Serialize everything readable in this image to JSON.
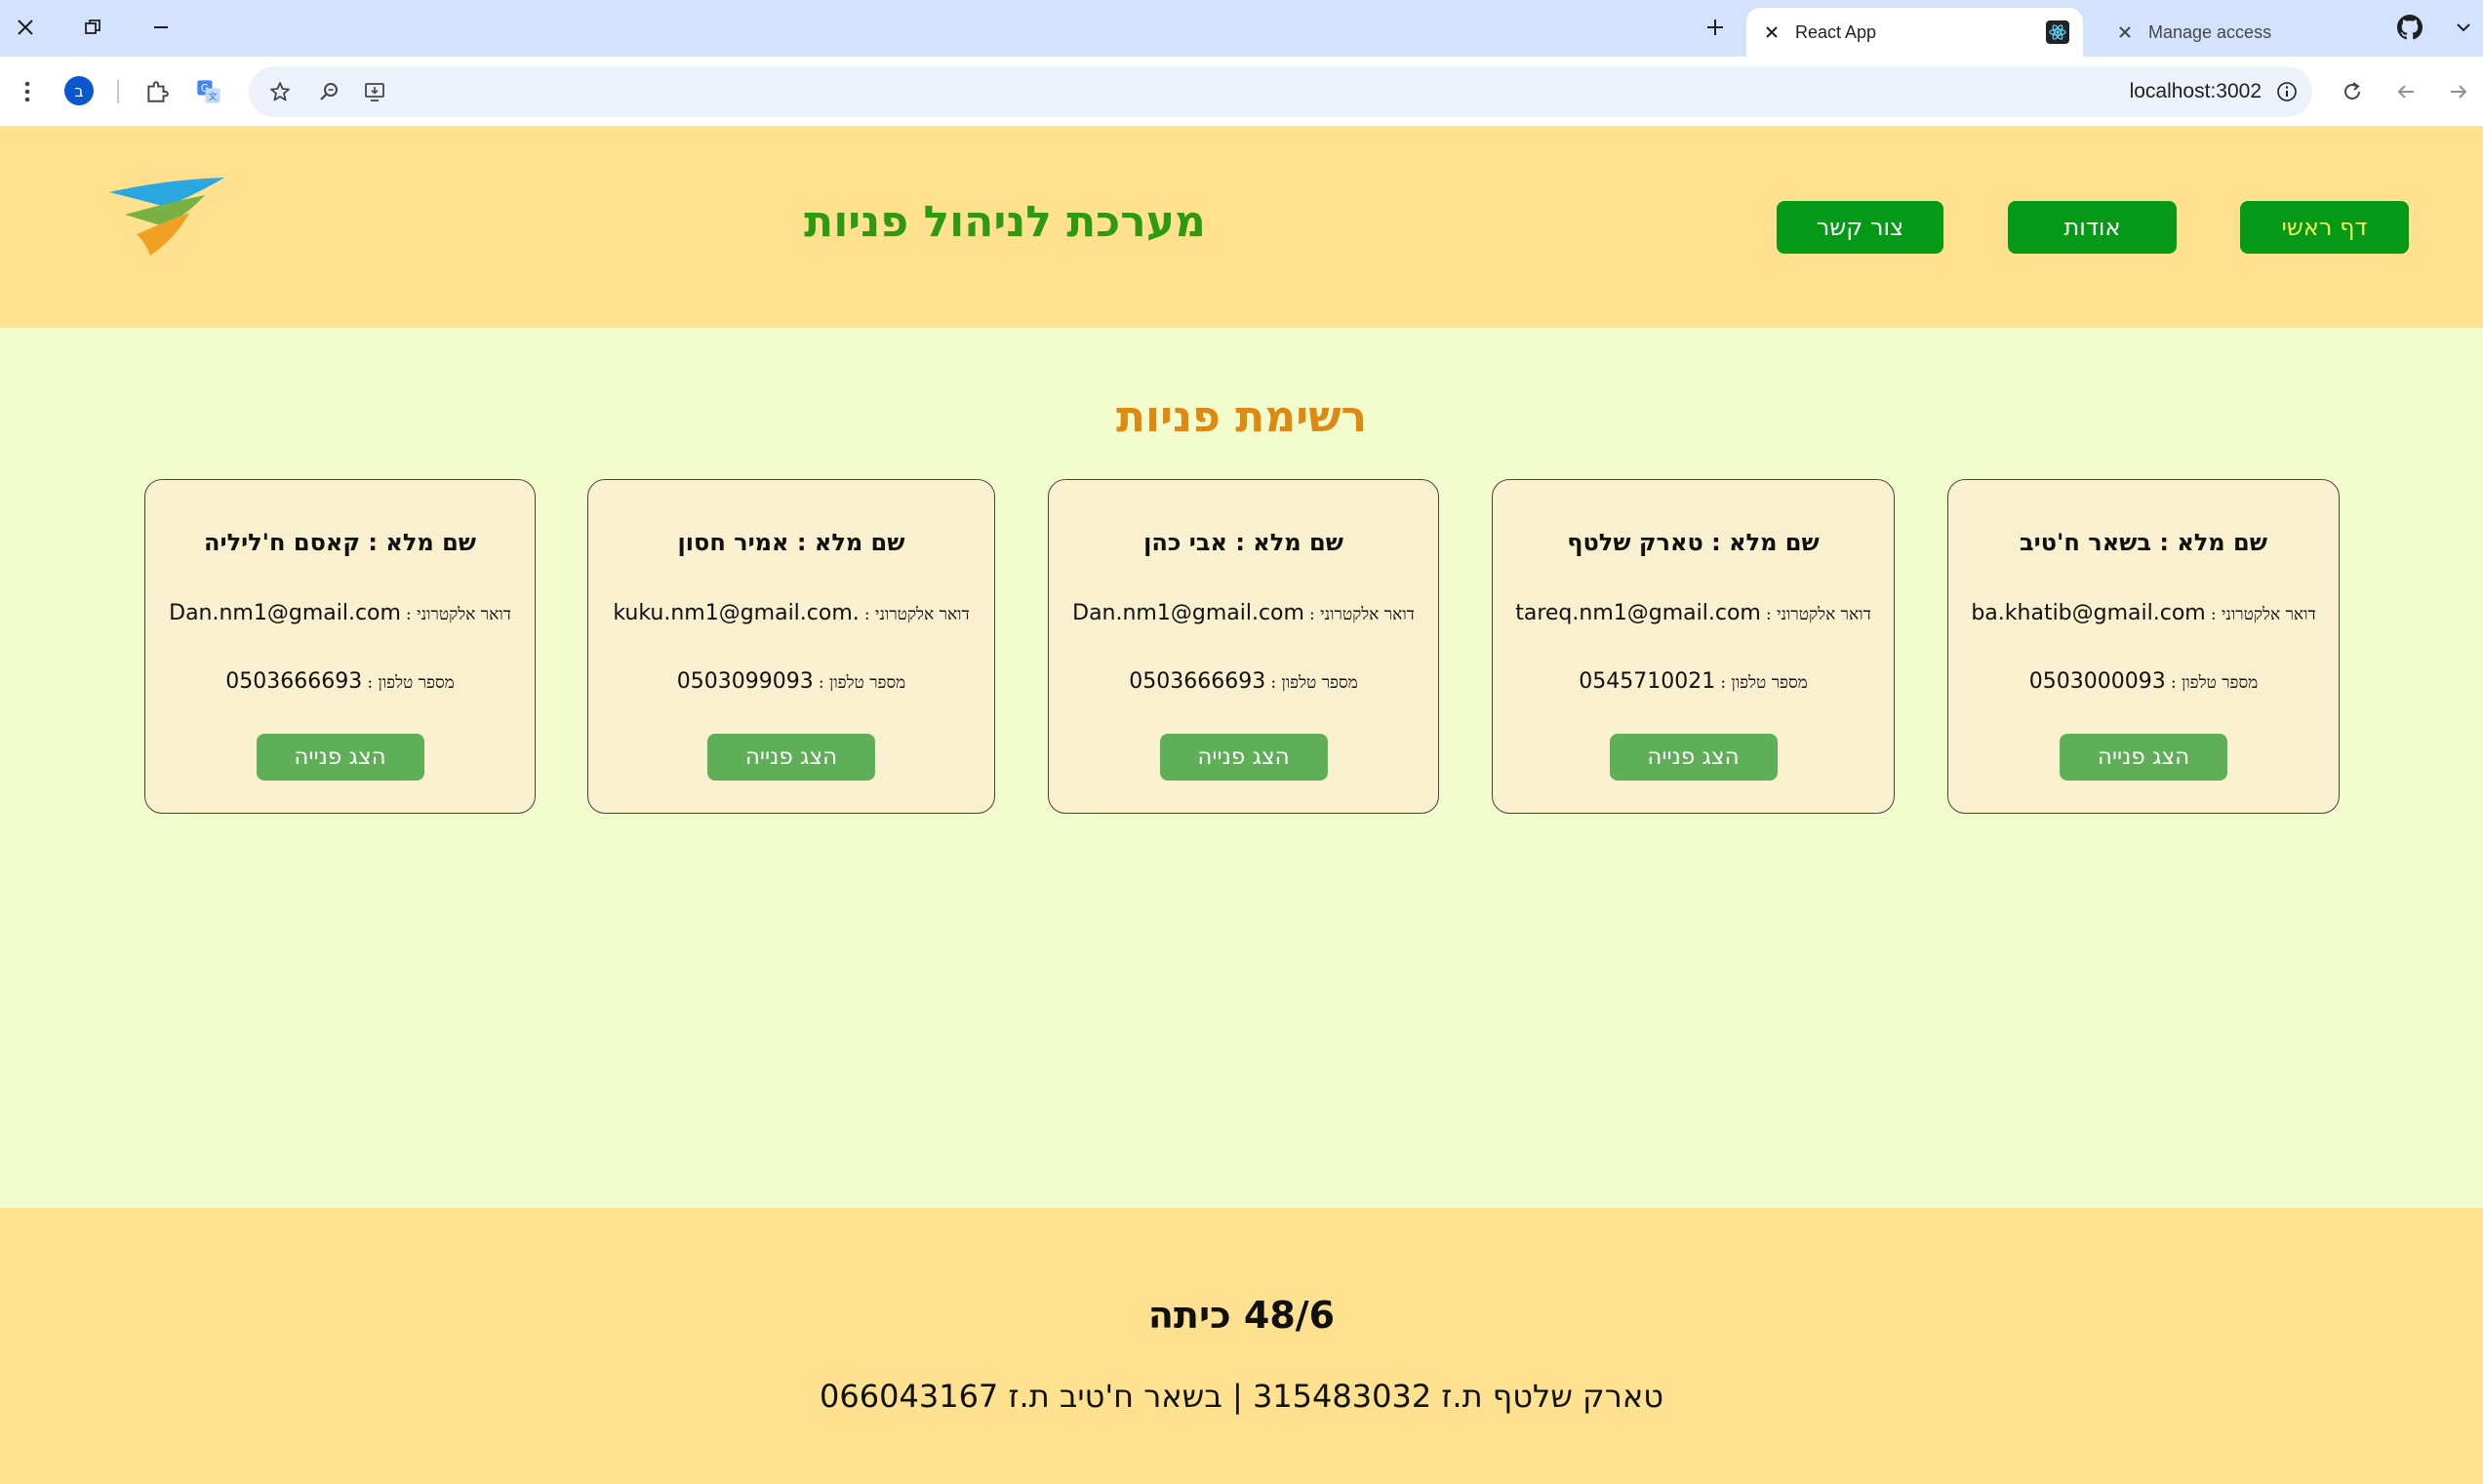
{
  "browser": {
    "tabs": [
      {
        "title": "Manage access"
      },
      {
        "title": "React App"
      }
    ],
    "url": "localhost:3002",
    "profile_initial": "ב"
  },
  "header": {
    "title": "מערכת לניהול פניות",
    "nav": {
      "home": "דף ראשי",
      "about": "אודות",
      "contact": "צור קשר"
    }
  },
  "main": {
    "title": "רשימת פניות",
    "name_label": "שם מלא :",
    "email_label": "דואר אלקטרוני :",
    "phone_label": "מספר טלפון :",
    "button_label": "הצג פנייה",
    "cards": [
      {
        "name": "בשאר ח'טיב",
        "email": "ba.khatib@gmail.com",
        "phone": "0503000093"
      },
      {
        "name": "טארק שלטף",
        "email": "tareq.nm1@gmail.com",
        "phone": "0545710021"
      },
      {
        "name": "אבי כהן",
        "email": "Dan.nm1@gmail.com",
        "phone": "0503666693"
      },
      {
        "name": "אמיר חסון",
        "email": "kuku.nm1@gmail.com.",
        "phone": "0503099093"
      },
      {
        "name": "קאסם ח'ליליה",
        "email": "Dan.nm1@gmail.com",
        "phone": "0503666693"
      }
    ]
  },
  "footer": {
    "class_label": "48/6 כיתה",
    "names": "טארק שלטף ת.ז 315483032 | בשאר ח'טיב ת.ז 066043167"
  },
  "colors": {
    "header_bg": "#ffe18f",
    "main_bg": "#f1fbcb",
    "title_green": "#2e9a10",
    "list_title_orange": "#de8a12",
    "nav_button": "#049a17",
    "card_button": "#5fae58",
    "card_bg": "#f9f0cf"
  }
}
